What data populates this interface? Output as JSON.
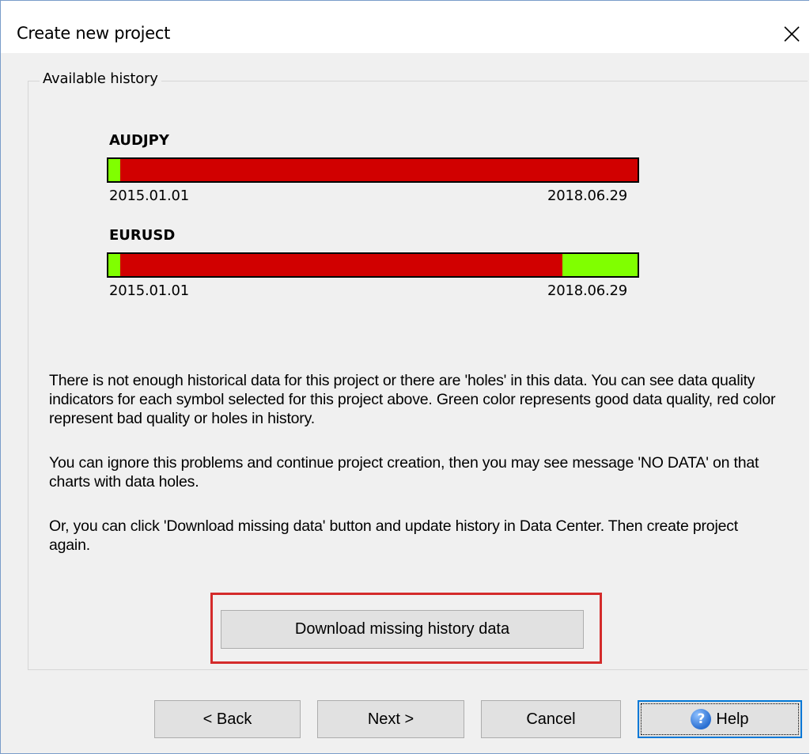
{
  "window": {
    "title": "Create new project"
  },
  "group": {
    "legend": "Available history"
  },
  "symbols": [
    {
      "name": "AUDJPY",
      "start_date": "2015.01.01",
      "end_date": "2018.06.29",
      "quality_segments": [
        {
          "status": "good",
          "from": 0.0,
          "to": 0.022
        },
        {
          "status": "bad",
          "from": 0.022,
          "to": 1.0
        }
      ]
    },
    {
      "name": "EURUSD",
      "start_date": "2015.01.01",
      "end_date": "2018.06.29",
      "quality_segments": [
        {
          "status": "good",
          "from": 0.0,
          "to": 0.022
        },
        {
          "status": "bad",
          "from": 0.022,
          "to": 0.858
        },
        {
          "status": "good",
          "from": 0.858,
          "to": 1.0
        }
      ]
    }
  ],
  "colors": {
    "good": "#80ff00",
    "bad": "#d10000",
    "highlight": "#d42b2b",
    "focus": "#0078d7"
  },
  "info": {
    "paragraph1": "There is not enough historical data for this project or there are 'holes' in this data. You can see data quality indicators for each symbol selected for this project above. Green color represents good data quality, red color represent bad quality or holes in history.",
    "paragraph2": "You can ignore this problems and continue project creation, then you may see message 'NO DATA' on that charts with data holes.",
    "paragraph3": "Or, you can click 'Download missing data' button and update history in Data Center. Then create project again."
  },
  "buttons": {
    "download": "Download missing history data",
    "back": "< Back",
    "next": "Next >",
    "cancel": "Cancel",
    "help": "Help"
  },
  "icons": {
    "close": "close-icon",
    "help": "help-icon"
  }
}
